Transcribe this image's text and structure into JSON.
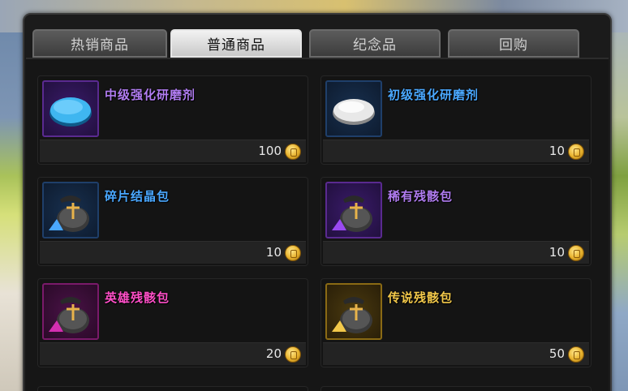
{
  "tabs": [
    {
      "label": "热销商品",
      "active": false
    },
    {
      "label": "普通商品",
      "active": true
    },
    {
      "label": "纪念品",
      "active": false
    },
    {
      "label": "回购",
      "active": false
    }
  ],
  "items": [
    {
      "name": "中级强化研磨剂",
      "price": "100",
      "name_color": "#b07cf0",
      "icon": "blue-polish-disc-icon",
      "frame_color": "#5a2a90"
    },
    {
      "name": "初级强化研磨剂",
      "price": "10",
      "name_color": "#4aa8ff",
      "icon": "white-polish-disc-icon",
      "frame_color": "#1f3f6a"
    },
    {
      "name": "碎片结晶包",
      "price": "10",
      "name_color": "#4aa8ff",
      "icon": "blue-crystal-bag-icon",
      "frame_color": "#1f3f6a"
    },
    {
      "name": "稀有残骸包",
      "price": "10",
      "name_color": "#b07cf0",
      "icon": "purple-crystal-bag-icon",
      "frame_color": "#5a2a90"
    },
    {
      "name": "英雄残骸包",
      "price": "20",
      "name_color": "#ff4fc8",
      "icon": "magenta-crystal-bag-icon",
      "frame_color": "#7a1a6a"
    },
    {
      "name": "传说残骸包",
      "price": "50",
      "name_color": "#f2c84a",
      "icon": "gold-crystal-bag-icon",
      "frame_color": "#8a6a14"
    }
  ],
  "currency_icon": "gold-coin-icon"
}
